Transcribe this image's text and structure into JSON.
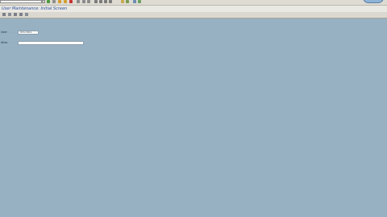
{
  "window": {
    "title": "User Maintenance: Initial Screen"
  },
  "std_toolbar": {
    "command_field_value": "",
    "icons": [
      "enter-icon",
      "save-icon",
      "back-icon",
      "exit-icon",
      "cancel-icon",
      "print-icon",
      "find-icon",
      "find-next-icon",
      "first-page-icon",
      "prev-page-icon",
      "next-page-icon",
      "last-page-icon",
      "new-session-icon",
      "shortcut-icon",
      "help-icon",
      "layout-icon"
    ]
  },
  "app_toolbar": {
    "icons": [
      "edit-icon",
      "display-icon",
      "copy-icon",
      "delete-icon",
      "lock-icon"
    ]
  },
  "form": {
    "user_label": "User",
    "user_value": "TEST001",
    "alias_label": "Alias",
    "alias_value": ""
  },
  "colors": {
    "background": "#97b1c3",
    "title_text": "#2a4fa0",
    "toolbar": "#dad8d0"
  }
}
